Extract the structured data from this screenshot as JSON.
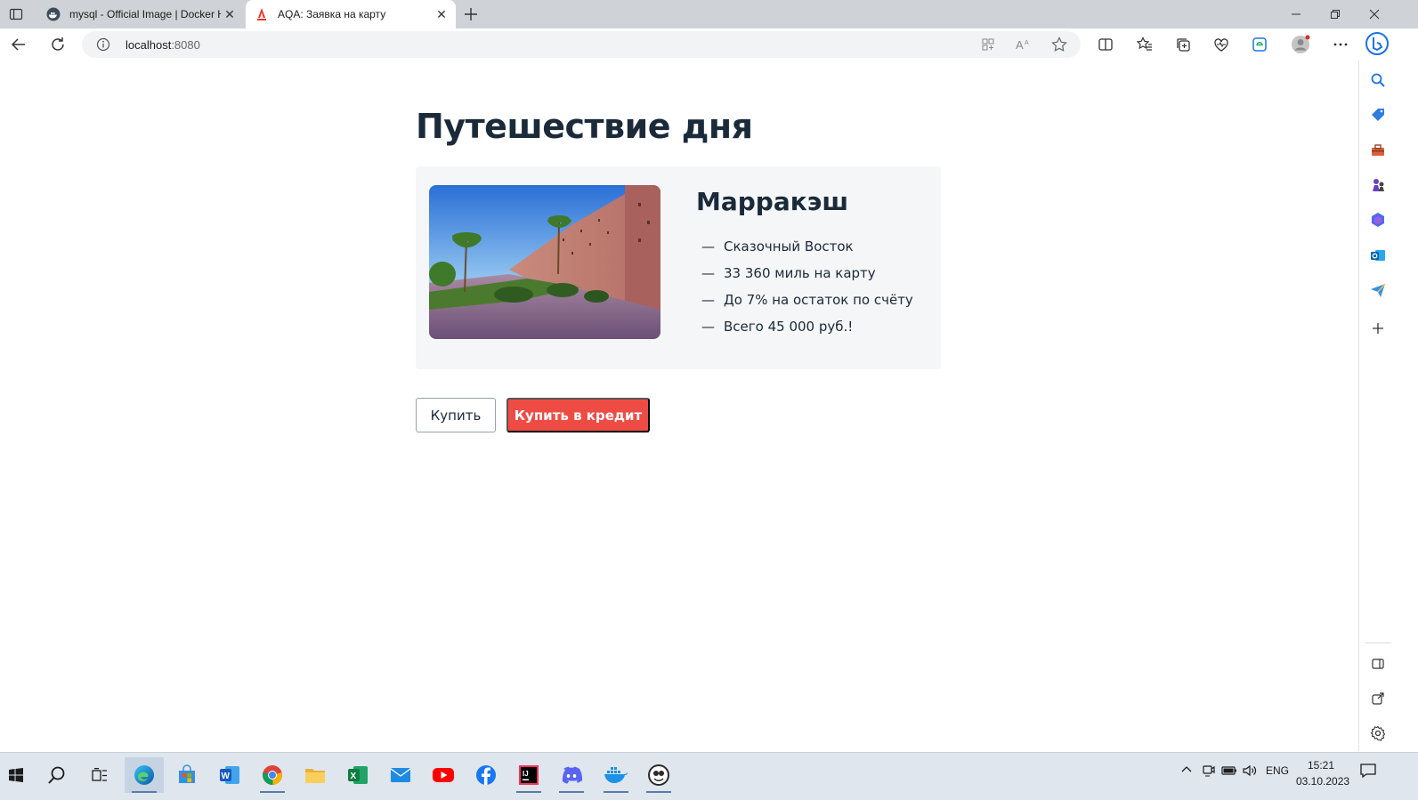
{
  "browser": {
    "tabs": [
      {
        "title": "mysql - Official Image | Docker H",
        "favicon": "docker-icon",
        "active": false
      },
      {
        "title": "AQA: Заявка на карту",
        "favicon": "alfa-icon",
        "active": true
      }
    ],
    "address": {
      "host": "localhost",
      "port": ":8080"
    }
  },
  "page": {
    "heading": "Путешествие дня",
    "card": {
      "city": "Марракэш",
      "features": [
        {
          "dash": "—",
          "text": "Сказочный Восток"
        },
        {
          "dash": "—",
          "text": "33 360 миль на карту"
        },
        {
          "dash": "—",
          "text": "До 7% на остаток по счёту"
        },
        {
          "dash": "—",
          "text": "Всего 45 000 руб.!"
        }
      ]
    },
    "buttons": {
      "buy": "Купить",
      "credit": "Купить в кредит"
    }
  },
  "taskbar": {
    "lang": "ENG",
    "time": "15:21",
    "date": "03.10.2023"
  },
  "colors": {
    "accent": "#ef4b45",
    "heading": "#1a2a3a"
  }
}
